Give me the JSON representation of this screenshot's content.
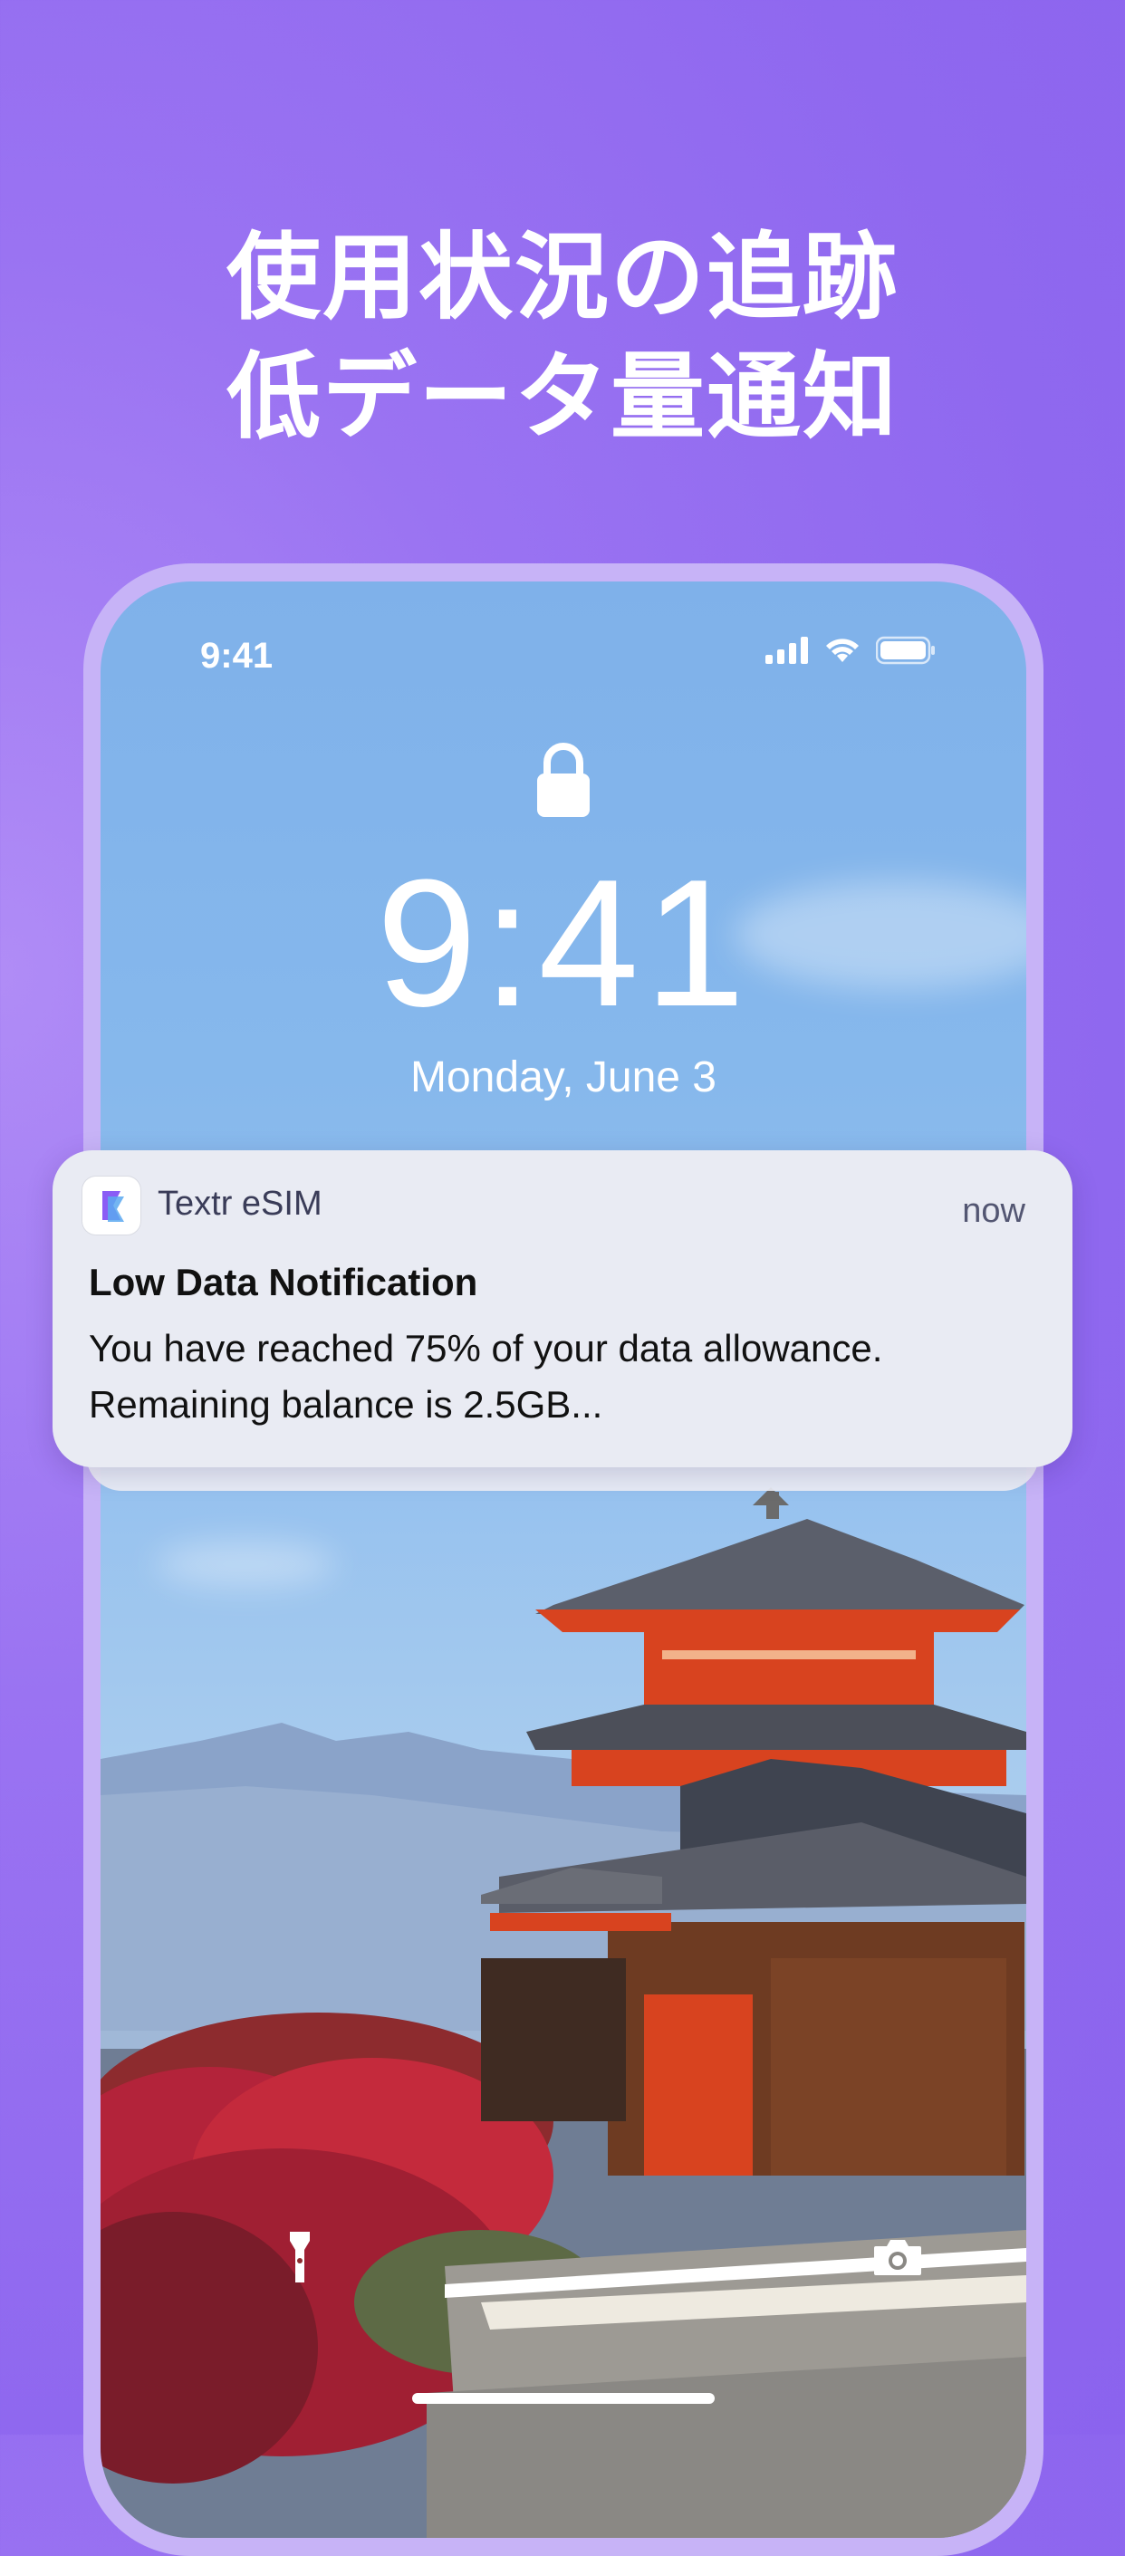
{
  "promo": {
    "title_line1": "使用状況の追跡",
    "title_line2": "低データ量通知"
  },
  "lockscreen": {
    "status_time": "9:41",
    "big_time": "9:41",
    "date": "Monday, June 3",
    "icons": [
      "signal-icon",
      "wifi-icon",
      "battery-icon",
      "lock-icon",
      "flashlight-icon",
      "camera-icon"
    ]
  },
  "notification": {
    "app_name": "Textr eSIM",
    "time": "now",
    "title": "Low Data Notification",
    "body": "You have reached 75% of your data allowance. Remaining balance is 2.5GB..."
  },
  "colors": {
    "background": "#9a73f2",
    "frame": "#c7b3f7",
    "notification_bg": "#e9ebf3"
  }
}
